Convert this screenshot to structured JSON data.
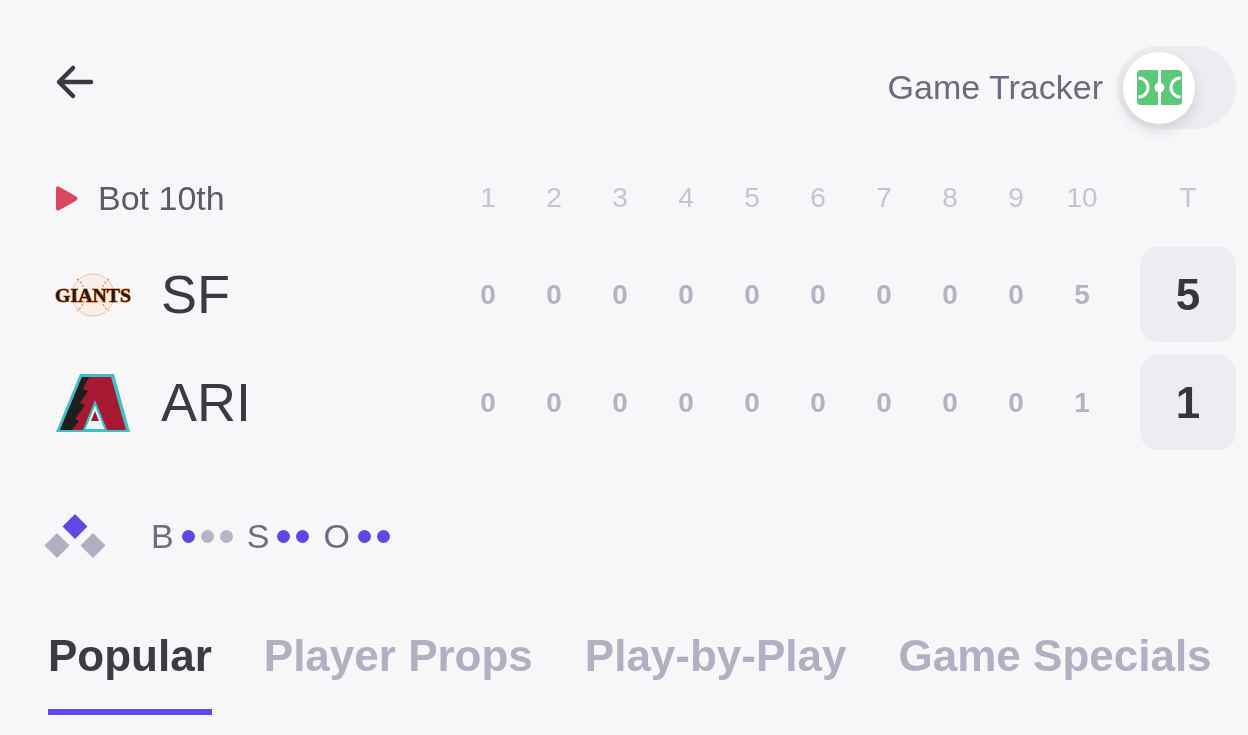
{
  "game_tracker": {
    "label": "Game Tracker",
    "on": false
  },
  "scoreboard": {
    "status": "Bot 10th",
    "innings": [
      "1",
      "2",
      "3",
      "4",
      "5",
      "6",
      "7",
      "8",
      "9",
      "10"
    ],
    "total_label": "T",
    "teams": [
      {
        "abbr": "SF",
        "logo": {
          "kind": "ball",
          "text": "GIANTS"
        },
        "runs": [
          "0",
          "0",
          "0",
          "0",
          "0",
          "0",
          "0",
          "0",
          "0",
          "5"
        ],
        "total": "5"
      },
      {
        "abbr": "ARI",
        "logo": {
          "kind": "peak"
        },
        "runs": [
          "0",
          "0",
          "0",
          "0",
          "0",
          "0",
          "0",
          "0",
          "0",
          "1"
        ],
        "total": "1"
      }
    ]
  },
  "bases": {
    "first": false,
    "second": true,
    "third": false
  },
  "count": [
    {
      "label": "B",
      "lights": [
        {
          "on": true
        },
        {
          "on": false
        },
        {
          "on": false
        }
      ]
    },
    {
      "label": "S",
      "lights": [
        {
          "on": true
        },
        {
          "on": true
        }
      ]
    },
    {
      "label": "O",
      "lights": [
        {
          "on": true
        },
        {
          "on": true
        }
      ]
    }
  ],
  "tabs": [
    {
      "label": "Popular",
      "selected": true
    },
    {
      "label": "Player Props",
      "selected": false
    },
    {
      "label": "Play-by-Play",
      "selected": false
    },
    {
      "label": "Game Specials",
      "selected": false
    }
  ]
}
